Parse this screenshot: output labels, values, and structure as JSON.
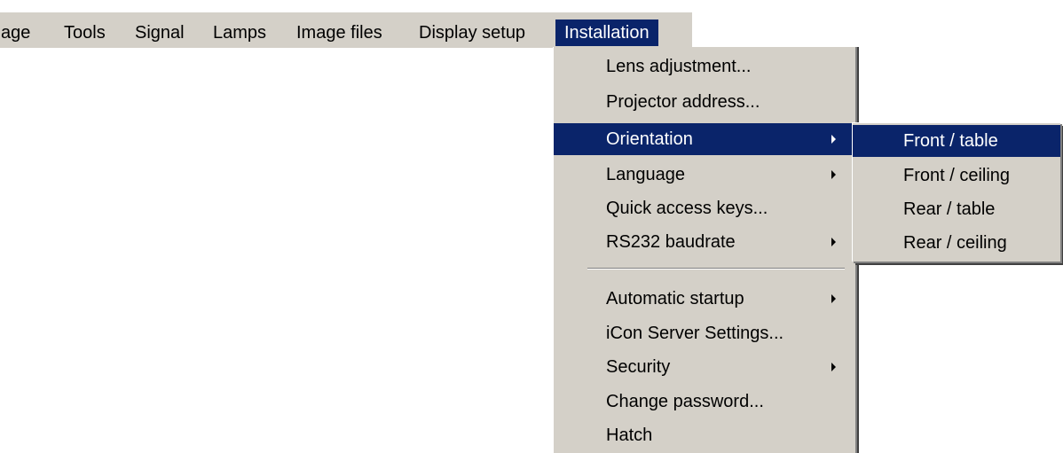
{
  "menubar": {
    "items": [
      {
        "label": "age",
        "active": false
      },
      {
        "label": "Tools",
        "active": false
      },
      {
        "label": "Signal",
        "active": false
      },
      {
        "label": "Lamps",
        "active": false
      },
      {
        "label": "Image files",
        "active": false
      },
      {
        "label": "Display setup",
        "active": false
      },
      {
        "label": "Installation",
        "active": true
      }
    ]
  },
  "installation_menu": {
    "items": [
      {
        "label": "Lens adjustment...",
        "has_submenu": false
      },
      {
        "label": "Projector address...",
        "has_submenu": false
      },
      {
        "label": "Orientation",
        "has_submenu": true,
        "highlighted": true
      },
      {
        "label": "Language",
        "has_submenu": true
      },
      {
        "label": "Quick access keys...",
        "has_submenu": false
      },
      {
        "label": "RS232 baudrate",
        "has_submenu": true
      },
      {
        "label": "Automatic startup",
        "has_submenu": true
      },
      {
        "label": "iCon Server Settings...",
        "has_submenu": false
      },
      {
        "label": "Security",
        "has_submenu": true
      },
      {
        "label": "Change password...",
        "has_submenu": false
      },
      {
        "label": "Hatch",
        "has_submenu": false
      }
    ]
  },
  "orientation_submenu": {
    "items": [
      {
        "label": "Front / table",
        "highlighted": true
      },
      {
        "label": "Front / ceiling"
      },
      {
        "label": "Rear / table"
      },
      {
        "label": "Rear / ceiling"
      }
    ]
  },
  "colors": {
    "menu_background": "#d4d0c8",
    "highlight_background": "#0a246a",
    "highlight_text": "#ffffff"
  },
  "icons": {
    "submenu_arrow": "submenu-arrow-icon"
  }
}
